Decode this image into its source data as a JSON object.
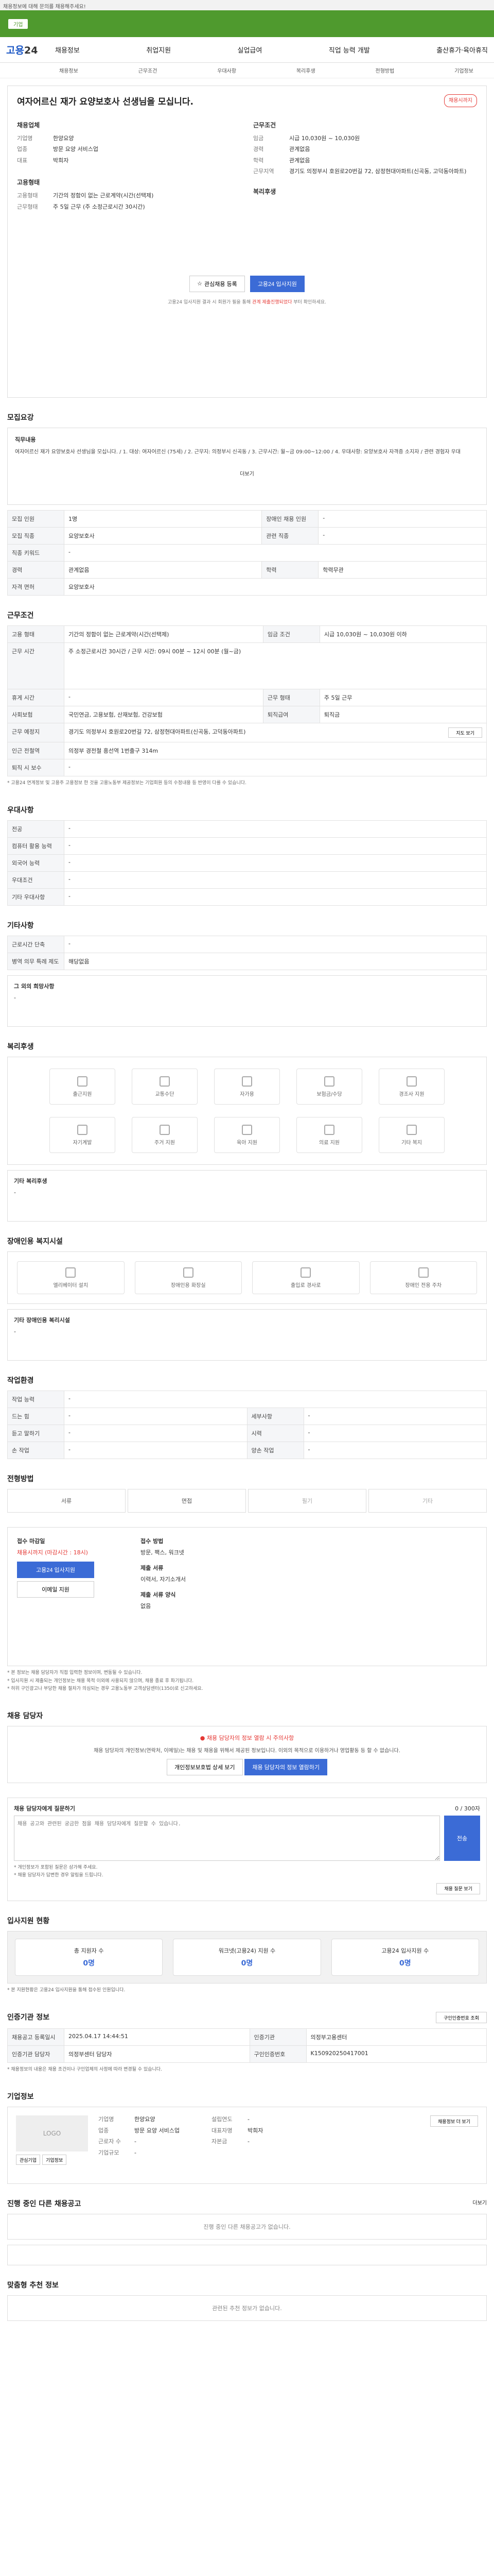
{
  "top": {
    "note": "채용정보에 대해 문의를 채용해주세요!",
    "banner": "기업"
  },
  "logo": {
    "a": "고용",
    "b": "24"
  },
  "gnb": [
    "채용정보",
    "취업지원",
    "실업급여",
    "직업 능력 개발",
    "출산휴가·육아휴직"
  ],
  "lnb": [
    "채용정보",
    "근무조건",
    "우대사항",
    "복리후생",
    "전형방법",
    "기업정보"
  ],
  "job": {
    "title": "여자어르신 재가 요양보호사 선생님을 모십니다.",
    "badge": "채용시까지",
    "company_h": "채용업체",
    "company": [
      {
        "k": "기업명",
        "v": "한양요양"
      },
      {
        "k": "업종",
        "v": "방문 요양 서비스업"
      },
      {
        "k": "대표",
        "v": "박희자"
      }
    ],
    "cond_h": "근무조건",
    "cond": [
      {
        "k": "임금",
        "v": "시급 10,030원 ~ 10,030원"
      },
      {
        "k": "경력",
        "v": "관계없음"
      },
      {
        "k": "학력",
        "v": "관계없음"
      },
      {
        "k": "근무지역",
        "v": "경기도 의정부시 호원로20번길 72, 삼정현대아파트(신곡동, 고덕동아파트)"
      }
    ],
    "hire_h": "고용형태",
    "hire": [
      {
        "k": "고용형태",
        "v": "기간의 정함이 없는 근로계약(시간(선택제)"
      },
      {
        "k": "근무형태",
        "v": "주 5일 근무 (주 소정근로시간 30시간)"
      }
    ],
    "welfare_h": "복리후생",
    "btn_fav": "관심채용 등록",
    "btn_apply": "고용24 입사지원",
    "note_a": "고용24 입사지원 결과 시 회원가 필을 통해",
    "note_b": "관계 제출진행되었다",
    "note_c": "부터 확인하세요."
  },
  "recruit": {
    "title": "모집요강",
    "desc_h": "직무내용",
    "desc": "여자어르신 재가 요양보호사 선생님을 모십니다. / 1. 대상: 여자어르신 (75세) / 2. 근무지: 의정부시 신곡동 / 3. 근무시간: 월~금 09:00~12:00 / 4. 우대사항: 요양보호사 자격증 소지자 / 관련 경험자 우대",
    "more": "더보기",
    "rows": [
      {
        "k": "모집 인원",
        "v": "1명",
        "k2": "장애인 채용 인원",
        "v2": "-"
      },
      {
        "k": "모집 직종",
        "v": "요양보호사",
        "k2": "관련 직종",
        "v2": "-"
      },
      {
        "k": "직종 키워드",
        "v": "-",
        "k2": "",
        "v2": ""
      },
      {
        "k": "경력",
        "v": "관계없음",
        "k2": "학력",
        "v2": "학력무관"
      },
      {
        "k": "자격 면허",
        "v": "요양보호사",
        "k2": "",
        "v2": ""
      }
    ]
  },
  "work": {
    "title": "근무조건",
    "rows": [
      {
        "k": "고용 형태",
        "v": "기간의 정함이 없는 근로계약(시간(선택제)",
        "k2": "임금 조건",
        "v2": "시급 10,030원 ~ 10,030원 이하"
      },
      {
        "k": "근무 시간",
        "v": "주 소정근로시간 30시간 / 근무 시간: 09시 00분 ~ 12시 00분 (월~금)",
        "k2": "",
        "v2": ""
      },
      {
        "k": "휴게 시간",
        "v": "-",
        "k2": "근무 형태",
        "v2": "주 5일 근무"
      },
      {
        "k": "사회보험",
        "v": "국민연금, 고용보험, 산재보험, 건강보험",
        "k2": "퇴직급여",
        "v2": "퇴직금"
      },
      {
        "k": "근무 예정지",
        "v": "경기도 의정부시 호원로20번길 72, 삼정현대아파트(신곡동, 고덕동아파트)",
        "k2": "",
        "v2": ""
      },
      {
        "k": "인근 전철역",
        "v": "의정부 경전철 흥선역 1번출구 314m",
        "k2": "",
        "v2": ""
      },
      {
        "k": "퇴직 시 보수",
        "v": "-",
        "k2": "",
        "v2": ""
      }
    ],
    "map_btn": "지도 보기",
    "foot": "* 고용24 연계정보 및 고용주 고용정보 한 것을 고용노동부 제공정보는 기업회원 등의 수정내용 등 반영이 다를 수 있습니다."
  },
  "pref": {
    "title": "우대사항",
    "rows": [
      {
        "k": "전공",
        "v": "-"
      },
      {
        "k": "컴퓨터 활용 능력",
        "v": "-"
      },
      {
        "k": "외국어 능력",
        "v": "-"
      },
      {
        "k": "우대조건",
        "v": "-"
      },
      {
        "k": "기타 우대사항",
        "v": "-"
      }
    ]
  },
  "other": {
    "title": "기타사항",
    "rows": [
      {
        "k": "근로시간 단축",
        "v": "-"
      },
      {
        "k": "병역 의무 특례 제도",
        "v": "해당없음"
      }
    ],
    "extra_h": "그 외의 희망사항",
    "extra": "-"
  },
  "welfare": {
    "title": "복리후생",
    "icons": [
      {
        "name": "meal-icon",
        "label": "출근지원"
      },
      {
        "name": "bus-icon",
        "label": "교통수단"
      },
      {
        "name": "car-icon",
        "label": "자가용"
      },
      {
        "name": "money-icon",
        "label": "보험금/수당"
      },
      {
        "name": "gift-icon",
        "label": "경조사 지원"
      },
      {
        "name": "study-icon",
        "label": "자기계발"
      },
      {
        "name": "house-icon",
        "label": "주거 지원"
      },
      {
        "name": "child-icon",
        "label": "육아 지원"
      },
      {
        "name": "medical-icon",
        "label": "의료 지원"
      },
      {
        "name": "etc-icon",
        "label": "기타 복지"
      }
    ],
    "etc_h": "기타 복리후생",
    "etc": "-"
  },
  "disability": {
    "title": "장애인용 복지시설",
    "icons": [
      "엘리베이터 설치",
      "장애인용 화장실",
      "출입로 경사로",
      "장애인 전용 주차"
    ],
    "etc_h": "기타 장애인용 복리시설",
    "etc": "-"
  },
  "disabled_env": {
    "title": "작업환경",
    "rows": [
      {
        "k": "작업 능력",
        "v": "-",
        "k2": "",
        "v2": ""
      },
      {
        "k": "드는 힘",
        "v": "-",
        "k2": "세부사항",
        "v2": "-"
      },
      {
        "k": "듣고 말하기",
        "v": "-",
        "k2": "시력",
        "v2": "-"
      },
      {
        "k": "손 작업",
        "v": "-",
        "k2": "양손 작업",
        "v2": "-"
      }
    ]
  },
  "process": {
    "title": "전형방법",
    "steps": [
      "서류",
      "면접",
      "필기",
      "기타"
    ]
  },
  "apply": {
    "l_h": "접수 마감일",
    "deadline": "채용시까지 (마감시간 : 18시)",
    "btn": "고용24 입사지원",
    "btn2": "이메일 지원",
    "r_h": "접수 방법",
    "methods": "방문, 팩스, 워크넷",
    "docs_h": "제출 서류",
    "docs": "이력서, 자기소개서",
    "fax_h": "제출 서류 양식",
    "fax": "없음",
    "notes": [
      "* 본 정보는 채용 담당자가 직접 입력한 정보이며, 변동될 수 있습니다.",
      "* 입사지원 시 제출되는 개인정보는 채용 목적 이외에 사용되지 않으며, 채용 종료 후 파기됩니다.",
      "* 허위 구인광고나 부당한 채용 절차가 의심되는 경우 고용노동부 고객상담센터(1350)로 신고하세요."
    ]
  },
  "contact": {
    "title": "채용 담당자",
    "warn": "채용 담당자의 정보 열람 시 주의사항",
    "warn_body": "채용 담당자의 개인정보(연락처, 이메일)는 채용 및 채용을 위해서 제공된 정보입니다. 이외의 목적으로 이용하거나 영업활동 등 할 수 없습니다.",
    "btn1": "개인정보보호법 상세 보기",
    "btn2": "채용 담당자의 정보 열람하기"
  },
  "inquiry": {
    "title": "채용 담당자에게 질문하기",
    "count": "0 / 300자",
    "placeholder": "채용 공고와 관련된 궁금한 점을 채용 담당자에게 질문할 수 있습니다.",
    "btn": "전송",
    "notes": [
      "* 개인정보가 포함된 질문은 삼가해 주세요.",
      "* 채용 담당자가 답변한 경우 알림을 드립니다."
    ],
    "more": "채용 질문 보기"
  },
  "stats": {
    "title": "입사지원 현황",
    "cards": [
      {
        "label": "총 지원자 수",
        "value": "0명"
      },
      {
        "label": "워크넷(고용24) 지원 수",
        "value": "0명"
      },
      {
        "label": "고용24 입사지원 수",
        "value": "0명"
      }
    ],
    "note": "* 본 지원현황은 고용24 입사지원을 통해 접수된 인원입니다."
  },
  "meta": {
    "title": "인증기관 정보",
    "btn": "구인인증번호 조회",
    "rows": [
      {
        "k": "채용공고 등록일시",
        "v": "2025.04.17 14:44:51",
        "k2": "인증기관",
        "v2": "의정부고용센터"
      },
      {
        "k": "인증기관 담당자",
        "v": "의정부센터 담당자",
        "k2": "구인인증번호",
        "v2": "K150920250417001"
      }
    ],
    "note": "* 채용정보의 내용은 채용 조건이나 구인업체의 사정에 따라 변경될 수 있습니다."
  },
  "company": {
    "title": "기업정보",
    "logo": "LOGO",
    "btn1": "관심기업",
    "btn2": "기업정보",
    "rows": [
      {
        "k": "기업명",
        "v": "한양요양",
        "k2": "설립연도",
        "v2": "-"
      },
      {
        "k": "업종",
        "v": "방문 요양 서비스업",
        "k2": "대표자명",
        "v2": "박희자"
      },
      {
        "k": "근로자 수",
        "v": "-",
        "k2": "자본금",
        "v2": "-"
      },
      {
        "k": "기업규모",
        "v": "-",
        "k2": "",
        "v2": ""
      }
    ],
    "btn3": "채용정보 더 보기"
  },
  "company_jobs": {
    "title": "진행 중인 다른 채용공고",
    "empty": "진행 중인 다른 채용공고가 없습니다.",
    "more": "더보기"
  },
  "similar": {
    "title": "맞춤형 추천 정보",
    "empty": "관련된 추천 정보가 없습니다."
  }
}
